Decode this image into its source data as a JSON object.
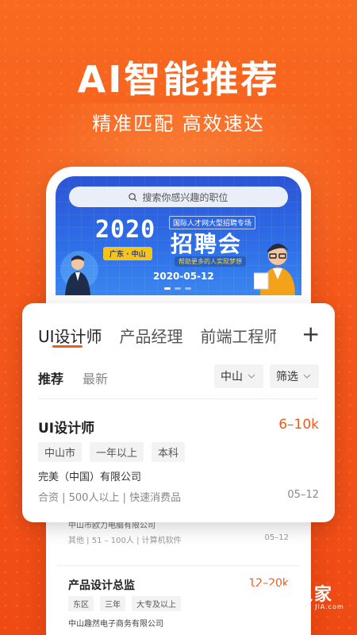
{
  "hero": {
    "headline": "AI智能推荐",
    "subline": "精准匹配 高效速达"
  },
  "banner": {
    "search_placeholder": "搜索你感兴趣的职位",
    "year": "2020",
    "location_tag": "广东 · 中山",
    "fair_subtitle": "国际人才网大型招聘专场",
    "fair_title": "招聘会",
    "slogan": "帮助更多的人实现梦想",
    "date": "2020-05-12"
  },
  "tabs": {
    "items": [
      "UI设计师",
      "产品经理",
      "前端工程师"
    ],
    "plus": "+"
  },
  "subtabs": {
    "recommend": "推荐",
    "latest": "最新"
  },
  "filters": {
    "city": "中山",
    "filter": "筛选"
  },
  "job": {
    "title": "UI设计师",
    "salary": "6–10k",
    "tags": [
      "中山市",
      "一年以上",
      "本科"
    ],
    "company": "完美（中国）有限公司",
    "meta": "合资 | 500人以上 | 快速消费品",
    "date": "05–12"
  },
  "bg_list": {
    "item1": {
      "company": "中山市欧力电脑有限公司",
      "meta": "其他 | 51 – 100人 | 计算机软件",
      "date": "05–12"
    },
    "item2": {
      "title": "产品设计总监",
      "salary": "12–20k",
      "tags": [
        "东区",
        "三年",
        "大专及以上"
      ],
      "company": "中山趣然电子商务有限公司"
    }
  },
  "watermark": {
    "name": "硬件之家",
    "sub": "YING JIAN ZHI JIA.com"
  },
  "colors": {
    "accent": "#f25a1b",
    "background": "#f4561a",
    "banner": "#2e6fe8"
  }
}
